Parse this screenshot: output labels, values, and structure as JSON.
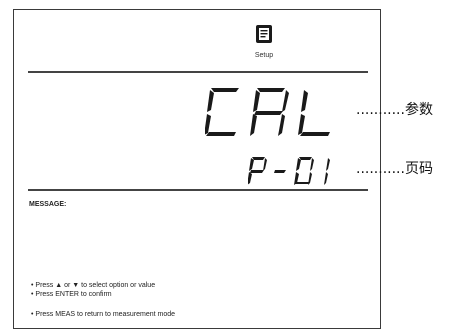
{
  "header": {
    "icon": "setup-document-icon",
    "mode_label": "Setup"
  },
  "display": {
    "parameter_code": "CAL",
    "page_code": "P-01"
  },
  "callouts": {
    "parameter": "...........参数",
    "page": "...........页码"
  },
  "message": {
    "title": "MESSAGE:",
    "help_lines": [
      "• Press ▲ or ▼ to select option or value",
      "• Press ENTER to confirm",
      "• Press MEAS to return to measurement mode"
    ]
  }
}
